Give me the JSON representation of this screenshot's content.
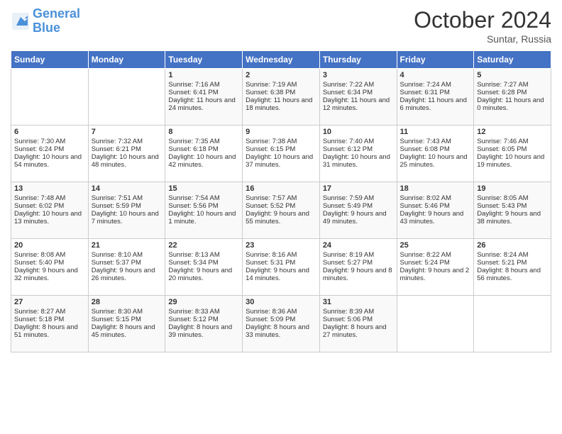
{
  "header": {
    "logo_line1": "General",
    "logo_line2": "Blue",
    "month": "October 2024",
    "location": "Suntar, Russia"
  },
  "days_of_week": [
    "Sunday",
    "Monday",
    "Tuesday",
    "Wednesday",
    "Thursday",
    "Friday",
    "Saturday"
  ],
  "weeks": [
    [
      {
        "num": "",
        "sunrise": "",
        "sunset": "",
        "daylight": ""
      },
      {
        "num": "",
        "sunrise": "",
        "sunset": "",
        "daylight": ""
      },
      {
        "num": "1",
        "sunrise": "Sunrise: 7:16 AM",
        "sunset": "Sunset: 6:41 PM",
        "daylight": "Daylight: 11 hours and 24 minutes."
      },
      {
        "num": "2",
        "sunrise": "Sunrise: 7:19 AM",
        "sunset": "Sunset: 6:38 PM",
        "daylight": "Daylight: 11 hours and 18 minutes."
      },
      {
        "num": "3",
        "sunrise": "Sunrise: 7:22 AM",
        "sunset": "Sunset: 6:34 PM",
        "daylight": "Daylight: 11 hours and 12 minutes."
      },
      {
        "num": "4",
        "sunrise": "Sunrise: 7:24 AM",
        "sunset": "Sunset: 6:31 PM",
        "daylight": "Daylight: 11 hours and 6 minutes."
      },
      {
        "num": "5",
        "sunrise": "Sunrise: 7:27 AM",
        "sunset": "Sunset: 6:28 PM",
        "daylight": "Daylight: 11 hours and 0 minutes."
      }
    ],
    [
      {
        "num": "6",
        "sunrise": "Sunrise: 7:30 AM",
        "sunset": "Sunset: 6:24 PM",
        "daylight": "Daylight: 10 hours and 54 minutes."
      },
      {
        "num": "7",
        "sunrise": "Sunrise: 7:32 AM",
        "sunset": "Sunset: 6:21 PM",
        "daylight": "Daylight: 10 hours and 48 minutes."
      },
      {
        "num": "8",
        "sunrise": "Sunrise: 7:35 AM",
        "sunset": "Sunset: 6:18 PM",
        "daylight": "Daylight: 10 hours and 42 minutes."
      },
      {
        "num": "9",
        "sunrise": "Sunrise: 7:38 AM",
        "sunset": "Sunset: 6:15 PM",
        "daylight": "Daylight: 10 hours and 37 minutes."
      },
      {
        "num": "10",
        "sunrise": "Sunrise: 7:40 AM",
        "sunset": "Sunset: 6:12 PM",
        "daylight": "Daylight: 10 hours and 31 minutes."
      },
      {
        "num": "11",
        "sunrise": "Sunrise: 7:43 AM",
        "sunset": "Sunset: 6:08 PM",
        "daylight": "Daylight: 10 hours and 25 minutes."
      },
      {
        "num": "12",
        "sunrise": "Sunrise: 7:46 AM",
        "sunset": "Sunset: 6:05 PM",
        "daylight": "Daylight: 10 hours and 19 minutes."
      }
    ],
    [
      {
        "num": "13",
        "sunrise": "Sunrise: 7:48 AM",
        "sunset": "Sunset: 6:02 PM",
        "daylight": "Daylight: 10 hours and 13 minutes."
      },
      {
        "num": "14",
        "sunrise": "Sunrise: 7:51 AM",
        "sunset": "Sunset: 5:59 PM",
        "daylight": "Daylight: 10 hours and 7 minutes."
      },
      {
        "num": "15",
        "sunrise": "Sunrise: 7:54 AM",
        "sunset": "Sunset: 5:56 PM",
        "daylight": "Daylight: 10 hours and 1 minute."
      },
      {
        "num": "16",
        "sunrise": "Sunrise: 7:57 AM",
        "sunset": "Sunset: 5:52 PM",
        "daylight": "Daylight: 9 hours and 55 minutes."
      },
      {
        "num": "17",
        "sunrise": "Sunrise: 7:59 AM",
        "sunset": "Sunset: 5:49 PM",
        "daylight": "Daylight: 9 hours and 49 minutes."
      },
      {
        "num": "18",
        "sunrise": "Sunrise: 8:02 AM",
        "sunset": "Sunset: 5:46 PM",
        "daylight": "Daylight: 9 hours and 43 minutes."
      },
      {
        "num": "19",
        "sunrise": "Sunrise: 8:05 AM",
        "sunset": "Sunset: 5:43 PM",
        "daylight": "Daylight: 9 hours and 38 minutes."
      }
    ],
    [
      {
        "num": "20",
        "sunrise": "Sunrise: 8:08 AM",
        "sunset": "Sunset: 5:40 PM",
        "daylight": "Daylight: 9 hours and 32 minutes."
      },
      {
        "num": "21",
        "sunrise": "Sunrise: 8:10 AM",
        "sunset": "Sunset: 5:37 PM",
        "daylight": "Daylight: 9 hours and 26 minutes."
      },
      {
        "num": "22",
        "sunrise": "Sunrise: 8:13 AM",
        "sunset": "Sunset: 5:34 PM",
        "daylight": "Daylight: 9 hours and 20 minutes."
      },
      {
        "num": "23",
        "sunrise": "Sunrise: 8:16 AM",
        "sunset": "Sunset: 5:31 PM",
        "daylight": "Daylight: 9 hours and 14 minutes."
      },
      {
        "num": "24",
        "sunrise": "Sunrise: 8:19 AM",
        "sunset": "Sunset: 5:27 PM",
        "daylight": "Daylight: 9 hours and 8 minutes."
      },
      {
        "num": "25",
        "sunrise": "Sunrise: 8:22 AM",
        "sunset": "Sunset: 5:24 PM",
        "daylight": "Daylight: 9 hours and 2 minutes."
      },
      {
        "num": "26",
        "sunrise": "Sunrise: 8:24 AM",
        "sunset": "Sunset: 5:21 PM",
        "daylight": "Daylight: 8 hours and 56 minutes."
      }
    ],
    [
      {
        "num": "27",
        "sunrise": "Sunrise: 8:27 AM",
        "sunset": "Sunset: 5:18 PM",
        "daylight": "Daylight: 8 hours and 51 minutes."
      },
      {
        "num": "28",
        "sunrise": "Sunrise: 8:30 AM",
        "sunset": "Sunset: 5:15 PM",
        "daylight": "Daylight: 8 hours and 45 minutes."
      },
      {
        "num": "29",
        "sunrise": "Sunrise: 8:33 AM",
        "sunset": "Sunset: 5:12 PM",
        "daylight": "Daylight: 8 hours and 39 minutes."
      },
      {
        "num": "30",
        "sunrise": "Sunrise: 8:36 AM",
        "sunset": "Sunset: 5:09 PM",
        "daylight": "Daylight: 8 hours and 33 minutes."
      },
      {
        "num": "31",
        "sunrise": "Sunrise: 8:39 AM",
        "sunset": "Sunset: 5:06 PM",
        "daylight": "Daylight: 8 hours and 27 minutes."
      },
      {
        "num": "",
        "sunrise": "",
        "sunset": "",
        "daylight": ""
      },
      {
        "num": "",
        "sunrise": "",
        "sunset": "",
        "daylight": ""
      }
    ]
  ]
}
